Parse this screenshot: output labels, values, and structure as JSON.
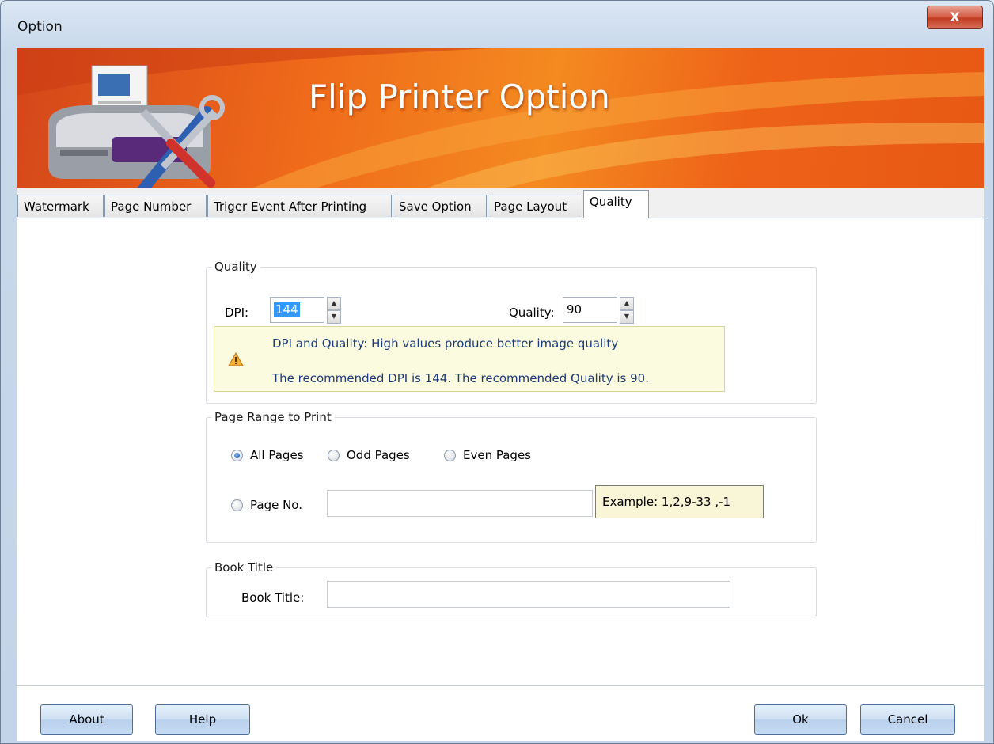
{
  "window": {
    "title": "Option",
    "close_glyph": "X"
  },
  "banner": {
    "title": "Flip Printer Option",
    "icon": "printer-tools-icon"
  },
  "tabs": [
    {
      "label": "Watermark",
      "active": false
    },
    {
      "label": "Page Number",
      "active": false
    },
    {
      "label": "Triger Event After Printing",
      "active": false
    },
    {
      "label": "Save Option",
      "active": false
    },
    {
      "label": "Page Layout",
      "active": false
    },
    {
      "label": "Quality",
      "active": true
    }
  ],
  "quality": {
    "legend": "Quality",
    "dpi_label": "DPI:",
    "dpi_value": "144",
    "quality_label": "Quality:",
    "quality_value": "90",
    "warning_line1": "DPI and Quality: High values produce better image quality",
    "warning_line2": "The recommended DPI is 144. The recommended Quality is 90.",
    "warning_icon": "warning-icon"
  },
  "page_range": {
    "legend": "Page Range to Print",
    "all_pages": "All Pages",
    "odd_pages": "Odd Pages",
    "even_pages": "Even Pages",
    "page_no": "Page No.",
    "page_no_value": "",
    "selected": "All Pages",
    "example": "Example: 1,2,9-33 ,-1"
  },
  "book_title": {
    "legend": "Book Title",
    "label": "Book Title:",
    "value": ""
  },
  "footer": {
    "about": "About",
    "help": "Help",
    "ok": "Ok",
    "cancel": "Cancel"
  },
  "colors": {
    "banner_orange": "#ef6a1a",
    "button_blue": "#cfe0f3",
    "warning_bg": "#fbfbdf"
  }
}
